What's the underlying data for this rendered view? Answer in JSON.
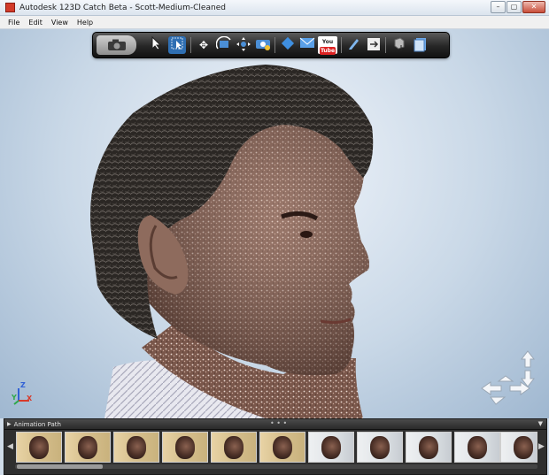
{
  "window": {
    "title": "Autodesk 123D Catch Beta - Scott-Medium-Cleaned",
    "controls": [
      "minimize",
      "maximize",
      "close"
    ]
  },
  "menu": [
    "File",
    "Edit",
    "View",
    "Help"
  ],
  "toolbar": {
    "buttons": [
      "camera-icon",
      "select-icon",
      "crop-select-icon",
      "pan-icon",
      "orbit-icon",
      "navigate-icon",
      "add-camera-icon",
      "view-camera-icon",
      "share-icon",
      "email-icon",
      "youtube-icon",
      "pen-icon",
      "reference-icon",
      "export-mesh-icon",
      "notes-icon"
    ],
    "youtube_label": "You Tube"
  },
  "axes": {
    "z": "Z",
    "y": "Y",
    "x": "X"
  },
  "animation_panel": {
    "title": "Animation Path",
    "grip": "• • •",
    "thumbnails": 11
  },
  "colors": {
    "toolbar_bg": "#262626",
    "viewport_bg": "#c9d8e7",
    "panel_bg": "#2f2f2f",
    "axis_x": "#d83a2a",
    "axis_y": "#2fa84a",
    "axis_z": "#2f5fd6"
  }
}
